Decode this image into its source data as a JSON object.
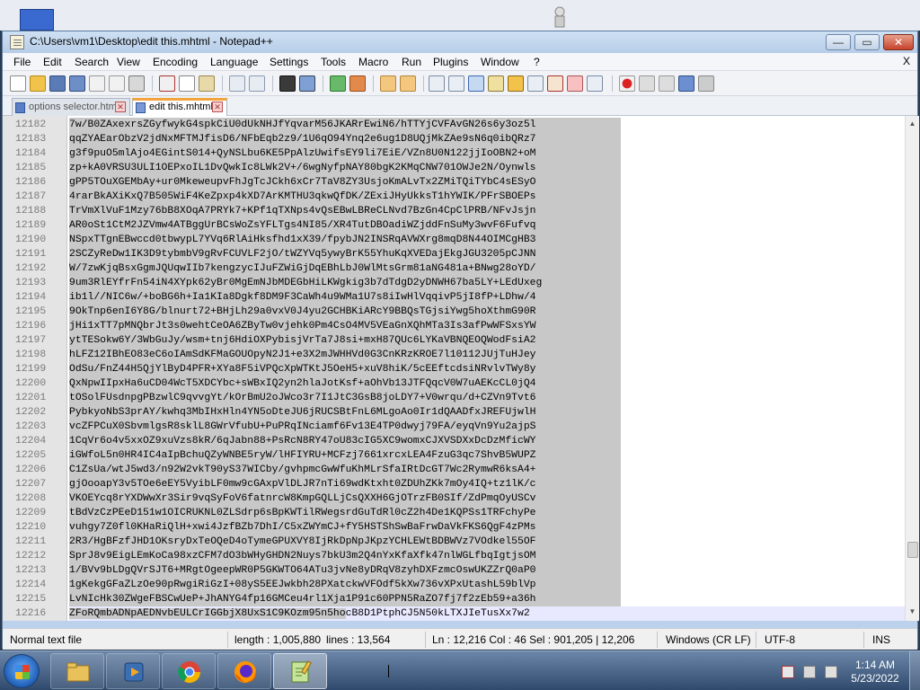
{
  "window": {
    "title": "C:\\Users\\vm1\\Desktop\\edit this.mhtml - Notepad++",
    "minimize_glyph": "—",
    "maximize_glyph": "▭",
    "close_glyph": "✕"
  },
  "menubar": {
    "items": [
      "File",
      "Edit",
      "Search",
      "View",
      "Encoding",
      "Language",
      "Settings",
      "Tools",
      "Macro",
      "Run",
      "Plugins",
      "Window",
      "?"
    ],
    "close": "X"
  },
  "tabs": [
    {
      "label": "options selector.html",
      "active": false
    },
    {
      "label": "edit this.mhtml",
      "active": true
    }
  ],
  "editor": {
    "lines": [
      {
        "n": "12182",
        "text": "7w/B0ZAxexrsZGyfwykG4spkCiU0dUkNHJfYqvarM56JKARrEwiN6/hTTYjCVFAvGN26s6y3oz5l"
      },
      {
        "n": "12183",
        "text": "qqZYAEarObzV2jdNxMFTMJfisD6/NFbEqb2z9/1U6qO94Ynq2e6ug1D8UQjMkZAe9sN6q0ibQRz7"
      },
      {
        "n": "12184",
        "text": "g3f9puO5mlAjo4EGintS014+QyNSLbu6KE5PpAlzUwifsEY9li7EiE/VZn8U0N122jjIoOBN2+oM"
      },
      {
        "n": "12185",
        "text": "zp+kA0VRSU3ULI1OEPxoIL1DvQwkIc8LWk2V+/6wgNyfpNAY80bgK2KMqCNW701OWJe2N/Oynwls"
      },
      {
        "n": "12186",
        "text": "gPP5TOuXGEMbAy+ur0MkeweupvFhJgTcJCkh6xCr7TaV8ZY3UsjoKmALvTx2ZMiTQiTYbC4sESyO"
      },
      {
        "n": "12187",
        "text": "4rarBkAXiKxQ7B505WiF4KeZpxp4kXD7ArKMTHU3qkwQfDK/ZExiJHyUkksT1hYWIK/PFrSBOEPs"
      },
      {
        "n": "12188",
        "text": "TrVmXlVuF1Mzy76bB8XOqA7PRYk7+KPf1qTXNps4vQsEBwLBReCLNvd7BzGn4CpClPRB/NFvJsjn"
      },
      {
        "n": "12189",
        "text": "AR0oSt1CtM2JZVmw4ATBggUrBCsWoZsYFLTgs4NI85/XR4TutDBOadiWZjddFnSuMy3wvF6Fufvq"
      },
      {
        "n": "12190",
        "text": "NSpxTTgnEBwccd0tbwypL7YVq6RlAiHksfhd1xX39/fpybJN2INSRqAVWXrg8mqD8N44OIMCgHB3"
      },
      {
        "n": "12191",
        "text": "2SCZyReDw1IK3D9tybmbV9gRvFCUVLF2jO/tWZYVq5ywyBrK55YhuKqXVEDajEkgJGU3205pCJNN"
      },
      {
        "n": "12192",
        "text": "W/7zwKjqBsxGgmJQUqwIIb7kengzycIJuFZWiGjDqEBhLbJ0WlMtsGrm81aNG481a+BNwg28oYD/"
      },
      {
        "n": "12193",
        "text": "9um3RlEYfrFn54iN4XYpk62yBr0MgEmNJbMDEGbHiLKWgkig3b7dTdgD2yDNWH67ba5LY+LEdUxeg"
      },
      {
        "n": "12194",
        "text": "ib1l//NIC6w/+boBG6h+Ia1KIa8Dgkf8DM9F3CaWh4u9WMa1U7s8iIwHlVqqivP5jI8fP+LDhw/4"
      },
      {
        "n": "12195",
        "text": "9OkTnp6enI6Y8G/blnurt72+BHjLh29a0vxV0J4yu2GCHBKiARcY9BBQsTGjsiYwg5hoXthmG90R"
      },
      {
        "n": "12196",
        "text": "jHi1xTT7pMNQbrJt3s0wehtCeOA6ZByTw0vjehk0Pm4CsO4MV5VEaGnXQhMTa3Is3afPwWFSxsYW"
      },
      {
        "n": "12197",
        "text": "ytTESokw6Y/3WbGuJy/wsm+tnj6HdiOXPybisjVrTa7J8si+mxH87QUc6LYKaVBNQEOQWodFsiA2"
      },
      {
        "n": "12198",
        "text": "hLFZ12IBhEO83eC6oIAmSdKFMaGOUOpyN2J1+e3X2mJWHHVd0G3CnKRzKROE7l10112JUjTuHJey"
      },
      {
        "n": "12199",
        "text": "OdSu/FnZ44H5QjYlByD4PFR+XYa8F5iVPQcXpWTKtJ5OeH5+xuV8hiK/5cEEftcdsiNRvlvTWy8y"
      },
      {
        "n": "12200",
        "text": "QxNpwIIpxHa6uCD04WcT5XDCYbc+sWBxIQ2yn2hlaJotKsf+aOhVb13JTFQqcV0W7uAEKcCL0jQ4"
      },
      {
        "n": "12201",
        "text": "tOSolFUsdnpgPBzwlC9qvvgYt/kOrBmU2oJWco3r7I1JtC3GsB8joLDY7+V0wrqu/d+CZVn9Tvt6"
      },
      {
        "n": "12202",
        "text": "PybkyoNbS3prAY/kwhq3MbIHxHln4YN5oDteJU6jRUCSBtFnL6MLgoAo0Ir1dQAADfxJREFUjwlH"
      },
      {
        "n": "12203",
        "text": "vcZFPCuX0SbvmlgsR8sklL8GWrVfubU+PuPRqINciamf6Fv13E4TP0dwyj79FA/eyqVn9Yu2ajpS"
      },
      {
        "n": "12204",
        "text": "1CqVr6o4v5xxOZ9xuVzs8kR/6qJabn88+PsRcN8RY47oU83cIG5XC9womxCJXVSDXxDcDzMficWY"
      },
      {
        "n": "12205",
        "text": "iGWfoL5n0HR4IC4aIpBchuQZyWNBE5ryW/lHFIYRU+MCFzj7661xrcxLEA4FzuG3qc7ShvB5WUPZ"
      },
      {
        "n": "12206",
        "text": "C1ZsUa/wtJ5wd3/n92W2vkT90yS37WICby/gvhpmcGwWfuKhMLrSfaIRtDcGT7Wc2RymwR6ksA4+"
      },
      {
        "n": "12207",
        "text": "gjOooapY3v5TOe6eEY5VyibLF0mw9cGAxpVlDLJR7nTi69wdKtxht0ZDUhZKk7mOy4IQ+tz1lK/c"
      },
      {
        "n": "12208",
        "text": "VKOEYcq8rYXDWwXr3Sir9vqSyFoV6fatnrcW8KmpGQLLjCsQXXH6GjOTrzFB0SIf/ZdPmqOyUSCv"
      },
      {
        "n": "12209",
        "text": "tBdVzCzPEeD151w1OICRUKNL0ZLSdrp6sBpKWTilRWegsrdGuTdRl0cZ2h4De1KQPSs1TRFchyPe"
      },
      {
        "n": "12210",
        "text": "vuhgy7Z0fl0KHaRiQlH+xwi4JzfBZb7DhI/C5xZWYmCJ+fY5HSTShSwBaFrwDaVkFKS6QgF4zPMs"
      },
      {
        "n": "12211",
        "text": "2R3/HgBFzfJHD1OKsryDxTeOQeD4oTymeGPUXVY8IjRkDpNpJKpzYCHLEWtBDBWVz7VOdkel55OF"
      },
      {
        "n": "12212",
        "text": "SprJ8v9EigLEmKoCa98xzCFM7dO3bWHyGHDN2Nuys7bkU3m2Q4nYxKfaXfk47nlWGLfbqIgtjsOM"
      },
      {
        "n": "12213",
        "text": "1/BVv9bLDgQVrSJT6+MRgtOgeepWR0P5GKWTO64ATu3jvNe8yDRqV8zyhDXFzmcOswUKZZrQ0aP0"
      },
      {
        "n": "12214",
        "text": "1gKekgGFaZLzOe90pRwgiRiGzI+08yS5EEJwkbh28PXatckwVFOdf5kXw736vXPxUtashL59blVp"
      },
      {
        "n": "12215",
        "text": "LvNIcHk30ZWgeFBSCwUeP+JhANYG4fp16GMCeu4rl1Xja1P91c60PPN5RaZO7fj7f2zEb59+a36h"
      },
      {
        "n": "12216",
        "text": "ZFoRQmbADNpAEDNvbEULCrIGGbjX8UxS1C9KOzm95n5hocB8D1PtphCJ5N50kLTXJIeTusXx7w2"
      }
    ]
  },
  "statusbar": {
    "doc_type": "Normal text file",
    "length": "length : 1,005,880",
    "lines": "lines : 13,564",
    "position": "Ln : 12,216    Col : 46    Sel : 901,205 | 12,206",
    "eol": "Windows (CR LF)",
    "encoding": "UTF-8",
    "mode": "INS"
  },
  "taskbar": {
    "apps": [
      "File Explorer",
      "Windows Media Player",
      "Google Chrome",
      "Firefox",
      "Notepad++"
    ],
    "clock_time": "1:14 AM",
    "clock_date": "5/23/2022"
  },
  "colors": {
    "selection": "#c8c8c8",
    "tab_accent": "#f3a33b",
    "taskbar": "#2f4a6d"
  }
}
